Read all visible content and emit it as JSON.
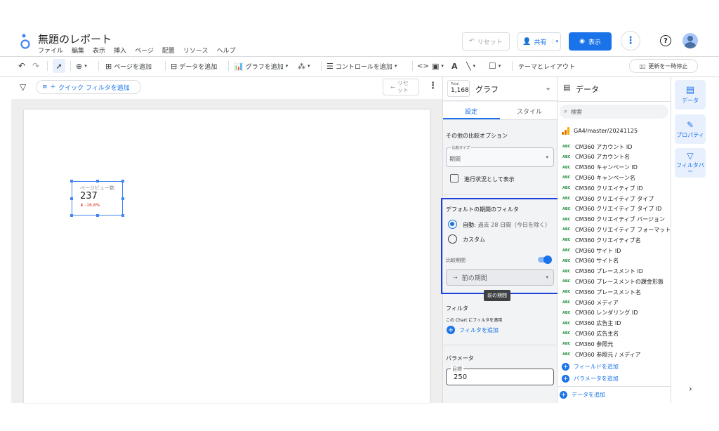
{
  "header": {
    "title": "無題のレポート",
    "menus": [
      "ファイル",
      "編集",
      "表示",
      "挿入",
      "ページ",
      "配置",
      "リソース",
      "ヘルプ"
    ],
    "reset": "リセット",
    "share": "共有",
    "view": "表示"
  },
  "toolbar": {
    "add_page": "ページを追加",
    "add_data": "データを追加",
    "add_chart": "グラフを追加",
    "add_control": "コントロールを追加",
    "theme_layout": "テーマとレイアウト",
    "pause_update": "更新を一時停止"
  },
  "filterbar": {
    "quick_filter": "クイック フィルタを追加",
    "reset": "リセット"
  },
  "scorecard": {
    "label": "ページビュー数",
    "value": "237",
    "delta": "-16.8%"
  },
  "chart_panel": {
    "total_label": "Total",
    "total_value": "1,168",
    "title": "グラフ",
    "tabs": [
      "設定",
      "スタイル"
    ],
    "compare_section": "その他の比較オプション",
    "compare_type_label": "比較タイプ",
    "compare_type_value": "期間",
    "progress_checkbox": "進行状況として表示",
    "default_period_title": "デフォルトの期間のフィルタ",
    "auto_label": "自動:",
    "auto_detail": "過去 28 日間（今日を除く）",
    "custom_label": "カスタム",
    "compare_period_label": "比較期間",
    "compare_period_value": "前の期間",
    "tooltip": "前の期間",
    "filter_section": "フィルタ",
    "filter_desc": "この Chart にフィルタを適用",
    "add_filter": "フィルタを追加",
    "param_section": "パラメータ",
    "param_label": "目標",
    "param_value": "250"
  },
  "data_panel": {
    "title": "データ",
    "search_placeholder": "検索",
    "source": "GA4/master/20241125",
    "fields": [
      "CM360 アカウント ID",
      "CM360 アカウント名",
      "CM360 キャンペーン ID",
      "CM360 キャンペーン名",
      "CM360 クリエイティブ ID",
      "CM360 クリエイティブ タイプ",
      "CM360 クリエイティブ タイプ ID",
      "CM360 クリエイティブ バージョン",
      "CM360 クリエイティブ フォーマット",
      "CM360 クリエイティブ名",
      "CM360 サイト ID",
      "CM360 サイト名",
      "CM360 プレースメント ID",
      "CM360 プレースメントの課金形態",
      "CM360 プレースメント名",
      "CM360 メディア",
      "CM360 レンダリング ID",
      "CM360 広告主 ID",
      "CM360 広告主名",
      "CM360 参照元",
      "CM360 参照元 / メディア"
    ],
    "abc": "ABC",
    "add_field": "フィールドを追加",
    "add_param": "パラメータを追加",
    "add_data": "データを追加"
  },
  "side_tabs": [
    "データ",
    "プロパティ",
    "フィルタバー"
  ],
  "colors": {
    "accent": "#1a73e8",
    "highlight_border": "#1e40d8",
    "negative": "#d93025"
  }
}
